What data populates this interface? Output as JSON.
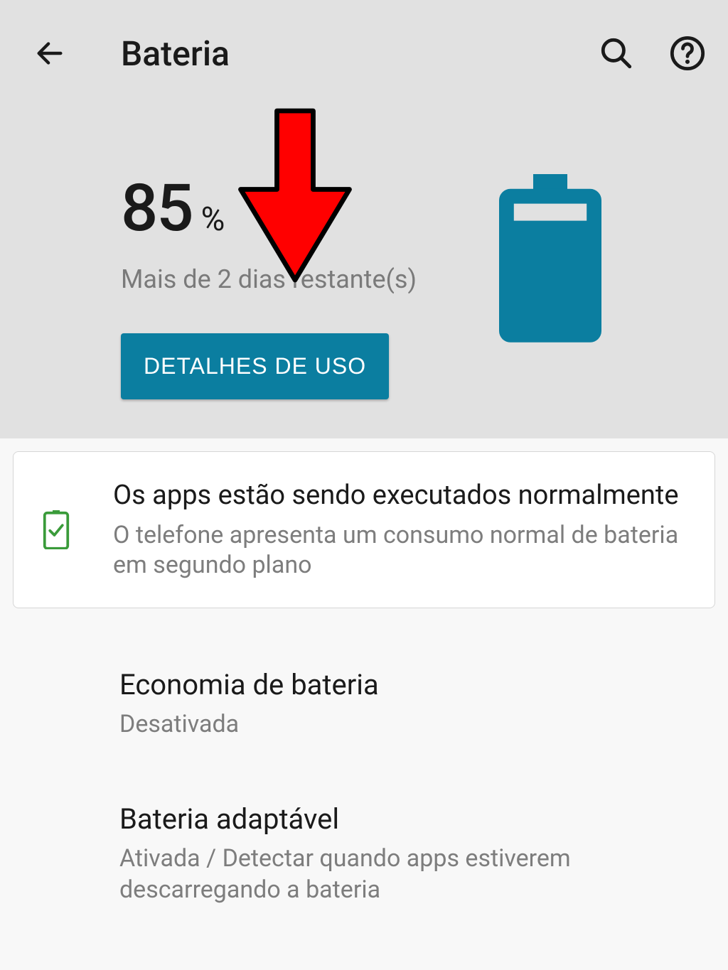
{
  "colors": {
    "accent": "#0b7ea0",
    "header_bg": "#e1e1e1",
    "text_primary": "#1a1a1a",
    "text_secondary": "#7d7d7d",
    "status_green": "#3a9b3a"
  },
  "header": {
    "title": "Bateria"
  },
  "battery": {
    "percent_value": "85",
    "percent_symbol": "%",
    "estimate": "Mais de 2 dias restante(s)",
    "usage_button": "DETALHES DE USO"
  },
  "status_card": {
    "title": "Os apps estão sendo executados normalmente",
    "subtitle": "O telefone apresenta um consumo normal de bateria em segundo plano"
  },
  "settings": [
    {
      "title": "Economia de bateria",
      "subtitle": "Desativada"
    },
    {
      "title": "Bateria adaptável",
      "subtitle": "Ativada / Detectar quando apps estiverem descarregando a bateria"
    }
  ]
}
